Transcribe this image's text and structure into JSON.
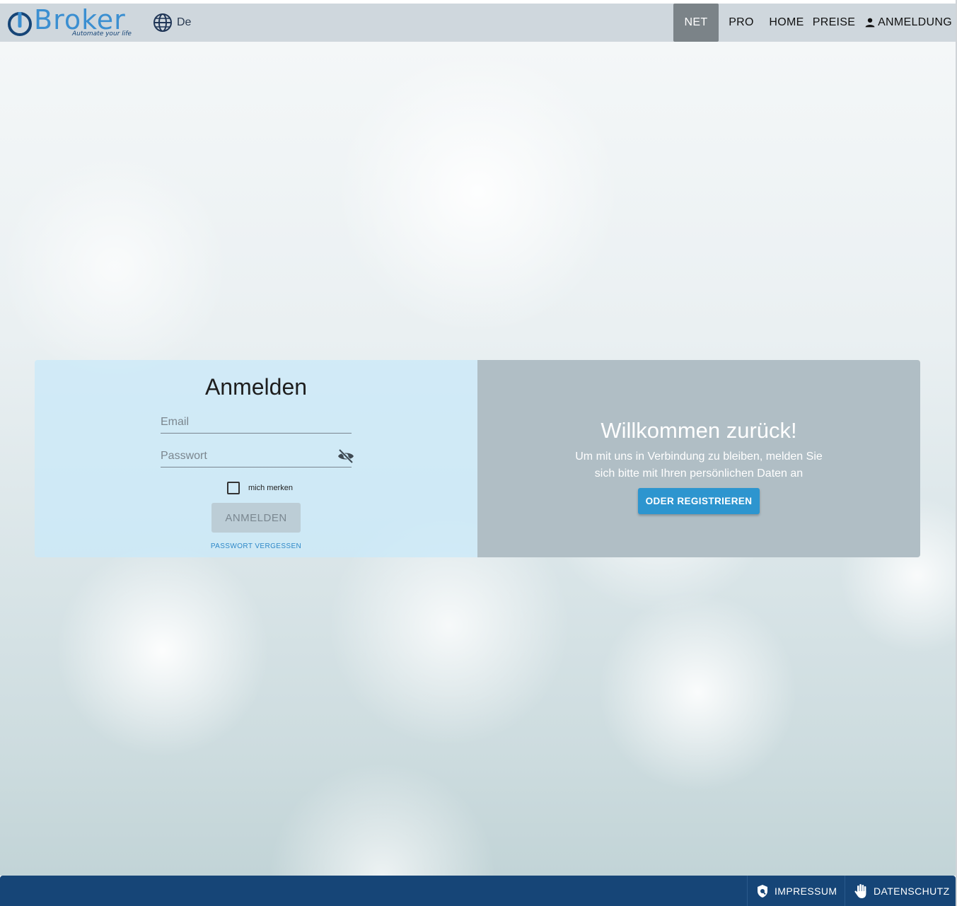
{
  "header": {
    "logo_text": "Broker",
    "logo_tagline": "Automate your life",
    "language": "De",
    "nav": {
      "net": "NET",
      "pro": "PRO",
      "home": "HOME",
      "preise": "PREISE",
      "login": "ANMELDUNG"
    }
  },
  "login": {
    "title": "Anmelden",
    "email_placeholder": "Email",
    "password_placeholder": "Passwort",
    "remember_label": "mich merken",
    "submit_label": "ANMELDEN",
    "forgot_label": "PASSWORT VERGESSEN"
  },
  "welcome": {
    "title": "Willkommen zurück!",
    "text": "Um mit uns in Verbindung zu bleiben, melden Sie sich bitte mit Ihren persönlichen Daten an",
    "register_label": "ODER REGISTRIEREN"
  },
  "footer": {
    "impressum": "IMPRESSUM",
    "datenschutz": "DATENSCHUTZ"
  },
  "icons": {
    "language": "globe-icon",
    "password_toggle": "eye-off-icon",
    "login": "person-icon",
    "impressum": "shield-icon",
    "datenschutz": "hand-icon"
  },
  "colors": {
    "topbar": "#cfd7dd",
    "active_nav": "#7b8388",
    "accent": "#2d95cf",
    "footer": "#164577"
  }
}
